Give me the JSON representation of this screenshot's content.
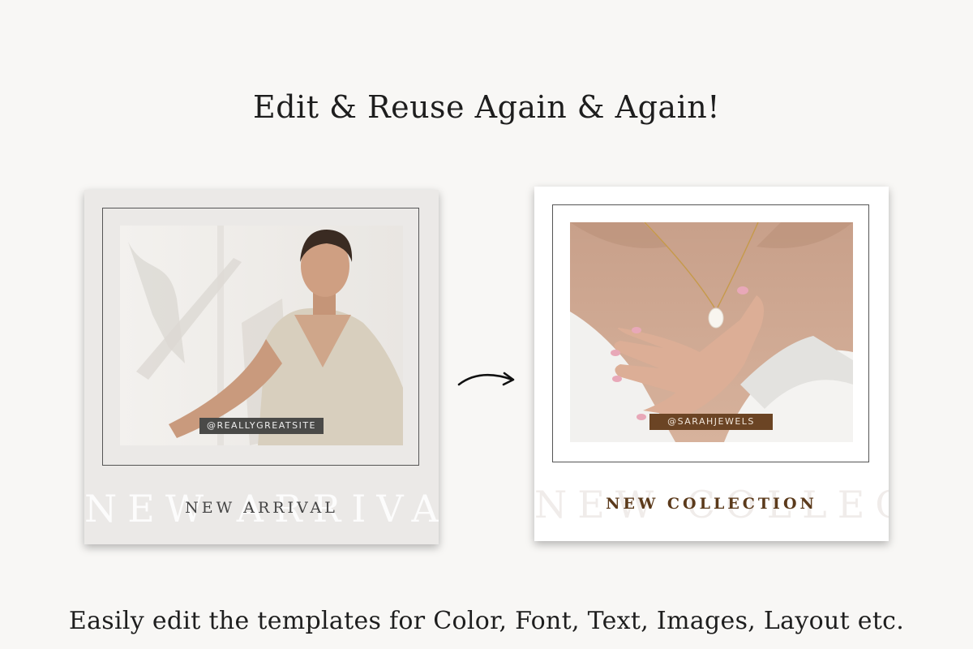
{
  "headline": "Edit & Reuse Again & Again!",
  "footer": "Easily edit the templates for Color, Font, Text, Images, Layout etc.",
  "cards": {
    "before": {
      "handle": "@REALLYGREATSITE",
      "ghost_text": "NEW ARRIVAL",
      "title": "NEW ARRIVAL",
      "background": "#ebe9e7",
      "handle_color": "#4a4a48"
    },
    "after": {
      "handle": "@SARAHJEWELS",
      "ghost_text": "NEW COLLECTION",
      "title": "NEW COLLECTION",
      "background": "#ffffff",
      "handle_color": "#6b4424"
    }
  },
  "icons": {
    "transition": "curved-arrow-right-icon"
  }
}
